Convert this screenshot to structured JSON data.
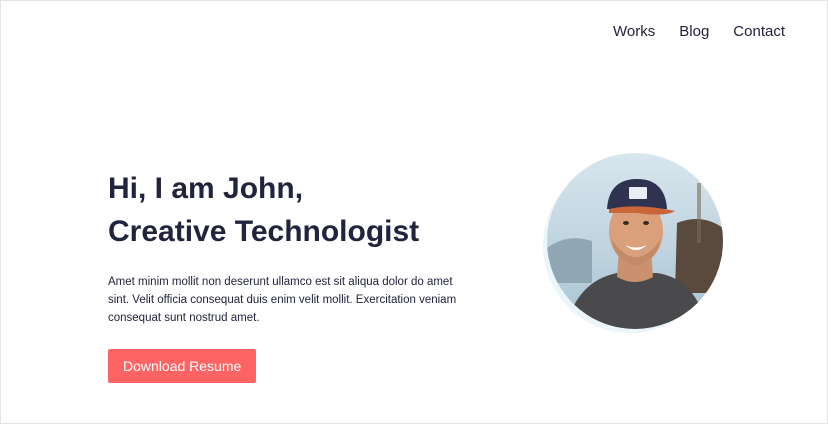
{
  "nav": {
    "items": [
      {
        "label": "Works"
      },
      {
        "label": "Blog"
      },
      {
        "label": "Contact"
      }
    ]
  },
  "hero": {
    "title_line1": "Hi, I am John,",
    "title_line2": "Creative Technologist",
    "description": "Amet minim mollit non deserunt ullamco est sit aliqua dolor do amet sint. Velit officia consequat duis enim velit mollit. Exercitation veniam consequat sunt nostrud amet.",
    "button_label": "Download Resume"
  },
  "colors": {
    "accent": "#ff6464",
    "text": "#21243d",
    "avatar_bg": "#eaf6fa"
  }
}
